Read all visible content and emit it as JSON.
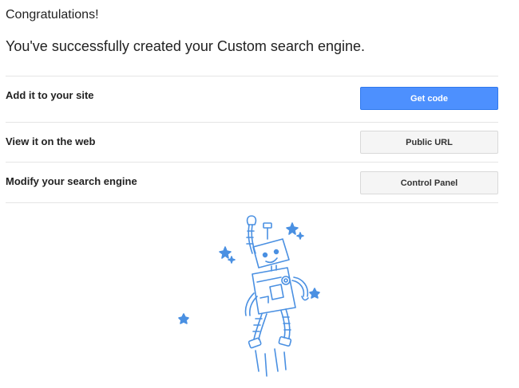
{
  "header": {
    "title": "Congratulations!",
    "message": "You've successfully created your Custom search engine."
  },
  "rows": [
    {
      "label": "Add it to your site",
      "button": "Get code"
    },
    {
      "label": "View it on the web",
      "button": "Public URL"
    },
    {
      "label": "Modify your search engine",
      "button": "Control Panel"
    }
  ],
  "colors": {
    "primary_button": "#4d90fe",
    "secondary_button": "#f5f5f5",
    "illustration_stroke": "#4a90e2"
  },
  "illustration": {
    "icon": "jumping-robot-icon"
  }
}
